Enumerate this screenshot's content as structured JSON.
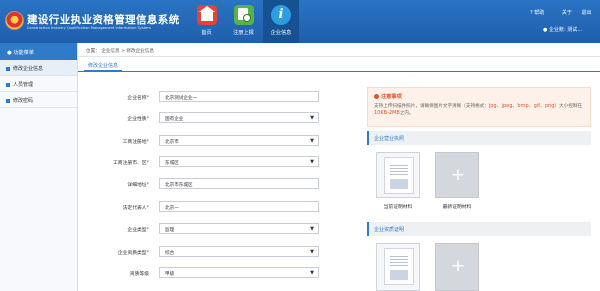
{
  "header": {
    "title": "建设行业执业资格管理信息系统",
    "subtitle": "Construction Industry Qualification Management Information System",
    "nav": [
      {
        "label": "首页",
        "icon": "home-icon"
      },
      {
        "label": "注册上报",
        "icon": "register-report-icon"
      },
      {
        "label": "企业信息",
        "icon": "info-icon"
      }
    ],
    "help": "帮助",
    "about": "关于",
    "exit": "退出",
    "user": "企业账: 测试..."
  },
  "sidebar": {
    "title": "功能菜单",
    "items": [
      {
        "label": "修改企业信息"
      },
      {
        "label": "人员管理"
      },
      {
        "label": "修改密码"
      }
    ]
  },
  "breadcrumb": "位置：  企业信息  >  修改企业信息",
  "tab": "修改企业信息",
  "form": {
    "company_name": {
      "label": "企业名称",
      "value": "北京测试企业一"
    },
    "company_type": {
      "label": "企业性质",
      "value": "国有企业"
    },
    "reg_place": {
      "label": "工商注册地",
      "value": "北京市"
    },
    "reg_district": {
      "label": "工商注册市、区",
      "value": "东城区"
    },
    "address": {
      "label": "详细地址",
      "value": "北京市东城区"
    },
    "legal_rep": {
      "label": "法定代表人",
      "value": "北京一"
    },
    "enterprise_type": {
      "label": "企业类型",
      "value": "监理"
    },
    "qualification_type": {
      "label": "企业资质类型",
      "value": "综合"
    },
    "qualification_level": {
      "label": "资质等级",
      "value": "甲级"
    }
  },
  "notice": {
    "title": "注意事项",
    "line1": "支持上传扫描件照片，请确保图片文字清晰（支持格式：",
    "formats": "jpg、jpeg、bmp、gif、png",
    "line2": "）大小控制在",
    "size": "10KB-2MB",
    "line3": "之内。"
  },
  "license_section": {
    "title": "企业营业执照",
    "current_caption": "当前证明材料",
    "new_caption": "最新证明材料",
    "plus": "+"
  },
  "qualification_section": {
    "title": "企业资质证明",
    "plus": "+"
  },
  "colors": {
    "header": "#1e5fab",
    "accent": "#2f7ac9",
    "warning": "#e0542b"
  }
}
